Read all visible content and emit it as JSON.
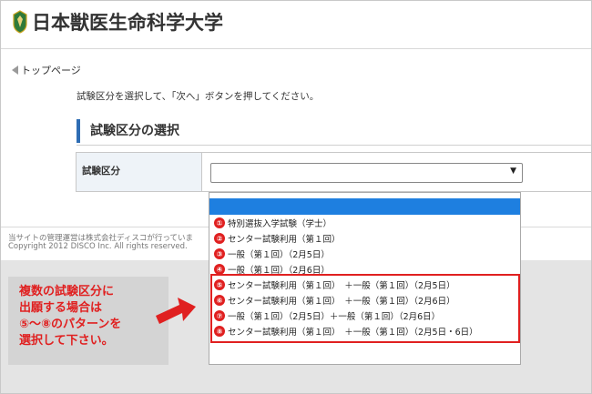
{
  "header": {
    "logo_text": "日本獣医生命科学大学",
    "logo_icon": "university-emblem-icon"
  },
  "nav": {
    "back_link": "トップページ"
  },
  "main": {
    "instruction": "試験区分を選択して、「次へ」ボタンを押してください。",
    "section_title": "試験区分の選択",
    "form_label": "試験区分",
    "select_value": ""
  },
  "dropdown": {
    "options": [
      {
        "num": "①",
        "label": "特別選抜入学試験（学士）"
      },
      {
        "num": "②",
        "label": "センター試験利用（第１回）"
      },
      {
        "num": "③",
        "label": "一般（第１回）（2月5日）"
      },
      {
        "num": "④",
        "label": "一般（第１回）（2月6日）"
      },
      {
        "num": "⑤",
        "label": "センター試験利用（第１回）　＋一般（第１回）（2月5日）"
      },
      {
        "num": "⑥",
        "label": "センター試験利用（第１回）　＋一般（第１回）（2月6日）"
      },
      {
        "num": "⑦",
        "label": "一般（第１回）（2月5日）＋一般（第１回）（2月6日）"
      },
      {
        "num": "⑧",
        "label": "センター試験利用（第１回）　＋一般（第１回）（2月5日・6日）"
      }
    ]
  },
  "footer": {
    "note": "当サイトの管理運営は株式会社ディスコが行っていま",
    "copyright": "Copyright 2012 DISCO Inc. All rights reserved."
  },
  "callout": {
    "line1": "複数の試験区分に",
    "line2": "出願する場合は",
    "line3": "⑤～⑧のパターンを",
    "line4": "選択して下さい。"
  },
  "colors": {
    "accent_blue": "#2e6db4",
    "highlight_blue": "#1e7fe0",
    "annotation_red": "#e02020"
  }
}
